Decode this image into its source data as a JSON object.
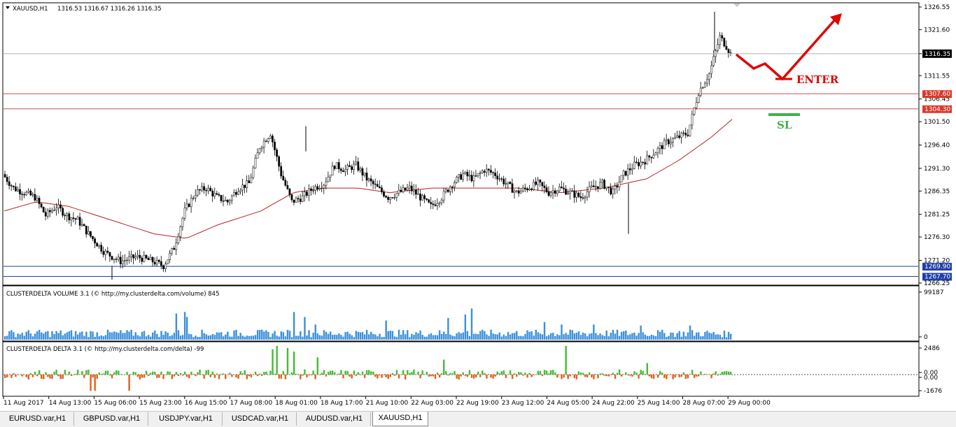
{
  "chart_data": [
    {
      "type": "candlestick",
      "header": {
        "symbol": "XAUUSD,H1",
        "ohlc": "1316.53 1316.67 1316.26 1316.35"
      },
      "y_axis": {
        "range": [
          1266.25,
          1326.55
        ],
        "ticks": [
          "1326.55",
          "1321.60",
          "1316.35",
          "1311.55",
          "1306.45",
          "1301.50",
          "1296.40",
          "1291.30",
          "1286.35",
          "1281.25",
          "1276.30",
          "1271.20",
          "1266.25"
        ]
      },
      "current_price": "1316.35",
      "horizontal_lines": [
        {
          "value": 1307.6,
          "label": "1307.60",
          "color": "#c0504d",
          "label_bg": "#d93a2b"
        },
        {
          "value": 1304.3,
          "label": "1304.30",
          "color": "#c0504d",
          "label_bg": "#d93a2b"
        },
        {
          "value": 1269.9,
          "label": "1269.90",
          "color": "#1f3fa8",
          "label_bg": "#1f3fa8"
        },
        {
          "value": 1267.7,
          "label": "1267.70",
          "color": "#1f3fa8",
          "label_bg": "#1f3fa8"
        }
      ],
      "annotations": [
        {
          "text": "ENTER",
          "color": "#e00000"
        },
        {
          "text": "SL",
          "color": "#3cb44b"
        }
      ],
      "x_axis": {
        "labels": [
          "11 Aug 2017",
          "14 Aug 13:00",
          "15 Aug 06:00",
          "15 Aug 23:00",
          "16 Aug 15:00",
          "17 Aug 08:00",
          "18 Aug 01:00",
          "18 Aug 17:00",
          "21 Aug 10:00",
          "22 Aug 03:00",
          "22 Aug 19:00",
          "23 Aug 12:00",
          "24 Aug 05:00",
          "24 Aug 22:00",
          "25 Aug 14:00",
          "28 Aug 07:00",
          "29 Aug 00:00"
        ]
      },
      "price_path_anchors": [
        [
          0,
          1290
        ],
        [
          10,
          1287
        ],
        [
          20,
          1286
        ],
        [
          30,
          1285
        ],
        [
          40,
          1281
        ],
        [
          50,
          1283
        ],
        [
          60,
          1281
        ],
        [
          70,
          1280
        ],
        [
          80,
          1277
        ],
        [
          95,
          1273
        ],
        [
          110,
          1271
        ],
        [
          125,
          1272
        ],
        [
          140,
          1271
        ],
        [
          150,
          1270
        ],
        [
          160,
          1274
        ],
        [
          170,
          1282
        ],
        [
          180,
          1286
        ],
        [
          190,
          1287
        ],
        [
          200,
          1285
        ],
        [
          210,
          1284
        ],
        [
          220,
          1287
        ],
        [
          230,
          1288
        ],
        [
          240,
          1296
        ],
        [
          250,
          1299
        ],
        [
          260,
          1290
        ],
        [
          270,
          1284
        ],
        [
          280,
          1285
        ],
        [
          290,
          1287
        ],
        [
          300,
          1288
        ],
        [
          310,
          1292
        ],
        [
          320,
          1291
        ],
        [
          330,
          1292
        ],
        [
          340,
          1289
        ],
        [
          350,
          1287
        ],
        [
          360,
          1285
        ],
        [
          370,
          1286
        ],
        [
          380,
          1287
        ],
        [
          390,
          1285
        ],
        [
          400,
          1283
        ],
        [
          410,
          1285
        ],
        [
          420,
          1288
        ],
        [
          430,
          1290
        ],
        [
          440,
          1289
        ],
        [
          450,
          1291
        ],
        [
          460,
          1290
        ],
        [
          470,
          1288
        ],
        [
          480,
          1286
        ],
        [
          490,
          1287
        ],
        [
          500,
          1288
        ],
        [
          510,
          1286
        ],
        [
          520,
          1287
        ],
        [
          530,
          1286
        ],
        [
          540,
          1285
        ],
        [
          550,
          1287
        ],
        [
          560,
          1288
        ],
        [
          570,
          1286
        ],
        [
          580,
          1290
        ],
        [
          590,
          1292
        ],
        [
          600,
          1293
        ],
        [
          610,
          1295
        ],
        [
          620,
          1297
        ],
        [
          630,
          1298
        ],
        [
          640,
          1299
        ],
        [
          650,
          1308
        ],
        [
          660,
          1312
        ],
        [
          670,
          1320
        ],
        [
          676,
          1318
        ],
        [
          680,
          1316.35
        ]
      ],
      "ma_path_anchors": [
        [
          0,
          1282
        ],
        [
          30,
          1284
        ],
        [
          60,
          1283
        ],
        [
          100,
          1280
        ],
        [
          140,
          1277
        ],
        [
          170,
          1276
        ],
        [
          200,
          1279
        ],
        [
          240,
          1282
        ],
        [
          270,
          1286
        ],
        [
          300,
          1287
        ],
        [
          330,
          1287
        ],
        [
          360,
          1286
        ],
        [
          400,
          1287
        ],
        [
          440,
          1287
        ],
        [
          480,
          1287
        ],
        [
          520,
          1286
        ],
        [
          560,
          1287
        ],
        [
          600,
          1289
        ],
        [
          630,
          1293
        ],
        [
          660,
          1298
        ],
        [
          680,
          1302
        ]
      ]
    },
    {
      "type": "bar",
      "title": "CLUSTERDELTA VOLUME 3.1 (© http://my.clusterdelta.com/volume) 845",
      "ticks": [
        "99187",
        "0"
      ],
      "y_range": [
        0,
        99187
      ],
      "color": "#3b8fdc"
    },
    {
      "type": "bar",
      "title": "CLUSTERDELTA DELTA 3.1 (© http://my.clusterdelta.com/delta) -99",
      "ticks": [
        "2486",
        "0.00",
        "0.00",
        "-1676"
      ],
      "y_range": [
        -1676,
        2486
      ],
      "pos_color": "#44bb33",
      "neg_color": "#e0601a"
    }
  ],
  "tabs": [
    {
      "label": "EURUSD.var,H1",
      "active": false
    },
    {
      "label": "GBPUSD.var,H1",
      "active": false
    },
    {
      "label": "USDJPY.var,H1",
      "active": false
    },
    {
      "label": "USDCAD.var,H1",
      "active": false
    },
    {
      "label": "AUDUSD.var,H1",
      "active": false
    },
    {
      "label": "XAUUSD,H1",
      "active": true
    }
  ]
}
